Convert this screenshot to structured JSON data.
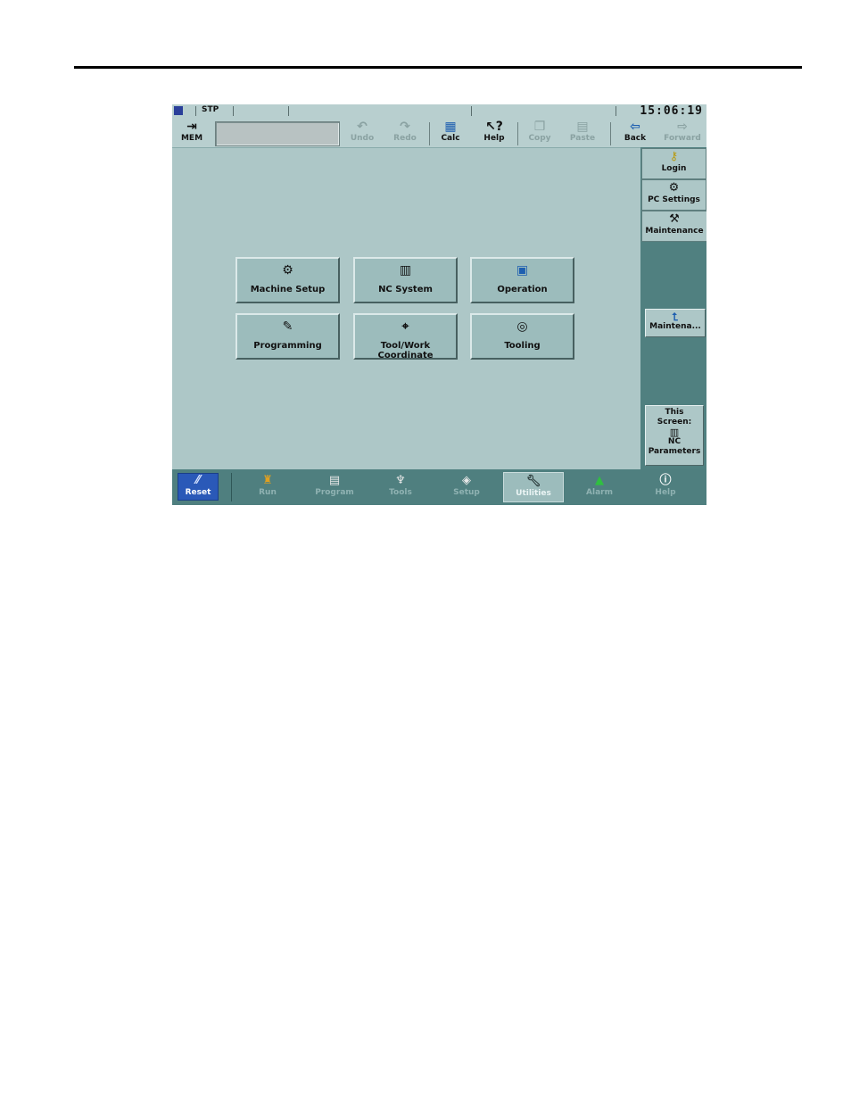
{
  "status": {
    "mode": "STP",
    "clock": "15:06:19"
  },
  "toolbar": {
    "mem": {
      "label": "MEM",
      "icon": "exit-arrow-icon"
    },
    "command_value": "",
    "buttons": [
      {
        "label": "Undo",
        "icon": "undo-icon",
        "enabled": false
      },
      {
        "label": "Redo",
        "icon": "redo-icon",
        "enabled": false
      },
      {
        "label": "Calc",
        "icon": "calculator-icon",
        "enabled": true
      },
      {
        "label": "Help",
        "icon": "help-cursor-icon",
        "enabled": true
      },
      {
        "label": "Copy",
        "icon": "copy-icon",
        "enabled": false
      },
      {
        "label": "Paste",
        "icon": "paste-icon",
        "enabled": false
      },
      {
        "label": "Back",
        "icon": "back-arrow-icon",
        "enabled": true
      },
      {
        "label": "Forward",
        "icon": "forward-arrow-icon",
        "enabled": false
      }
    ]
  },
  "side": {
    "tabs": [
      {
        "label": "Login",
        "icon": "key-icon"
      },
      {
        "label": "PC Settings",
        "icon": "settings-icon"
      },
      {
        "label": "Maintenance",
        "icon": "maintenance-icon"
      }
    ],
    "action": {
      "label": "Maintena...",
      "icon": "up-arrow-icon"
    },
    "this_screen": {
      "line1": "This",
      "line2": "Screen:",
      "line3": "NC",
      "line4": "Parameters",
      "icon": "nc-parameters-icon"
    }
  },
  "main": {
    "buttons": [
      {
        "label": "Machine Setup",
        "icon": "machine-setup-icon"
      },
      {
        "label": "NC System",
        "icon": "nc-system-icon"
      },
      {
        "label": "Operation",
        "icon": "operation-icon"
      },
      {
        "label": "Programming",
        "icon": "programming-icon"
      },
      {
        "label": "Tool/Work Coordinate",
        "icon": "tool-coordinate-icon"
      },
      {
        "label": "Tooling",
        "icon": "tooling-icon"
      }
    ]
  },
  "bottom": {
    "reset": {
      "label": "Reset",
      "icon": "reset-icon"
    },
    "nav": [
      {
        "label": "Run",
        "icon": "run-icon",
        "active": false
      },
      {
        "label": "Program",
        "icon": "program-icon",
        "active": false
      },
      {
        "label": "Tools",
        "icon": "tools-icon",
        "active": false
      },
      {
        "label": "Setup",
        "icon": "setup-icon",
        "active": false
      },
      {
        "label": "Utilities",
        "icon": "wrench-icon",
        "active": true
      },
      {
        "label": "Alarm",
        "icon": "alarm-icon",
        "active": false
      },
      {
        "label": "Help",
        "icon": "info-icon",
        "active": false
      }
    ]
  },
  "colors": {
    "screen_bg": "#adc7c7",
    "panel_dark": "#508080",
    "reset_blue": "#2a59b8"
  }
}
